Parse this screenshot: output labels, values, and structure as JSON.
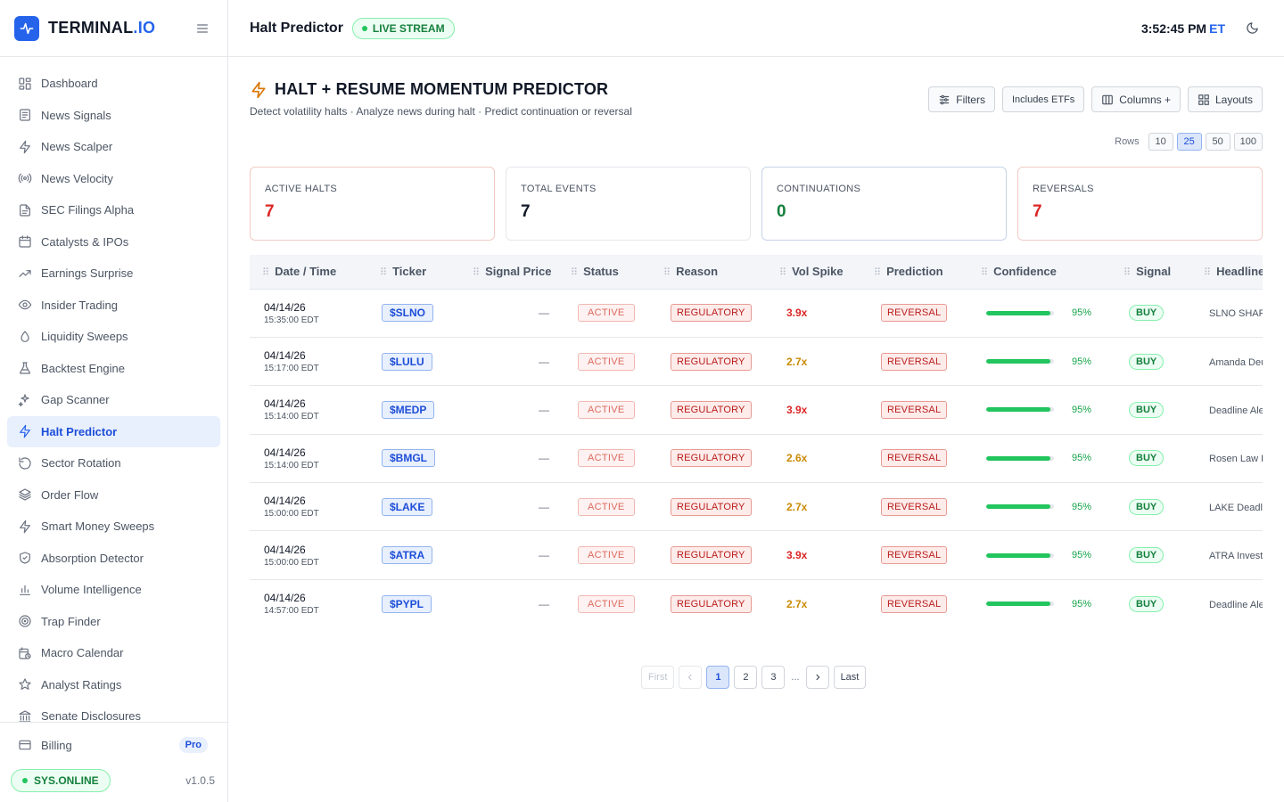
{
  "app": {
    "brand_main": "TERMINAL",
    "brand_accent": ".IO",
    "accent_color": "#2563eb"
  },
  "sidebar": {
    "items": [
      {
        "label": "Dashboard",
        "icon": "grid-icon"
      },
      {
        "label": "News Signals",
        "icon": "newspaper-icon"
      },
      {
        "label": "News Scalper",
        "icon": "bolt-icon"
      },
      {
        "label": "News Velocity",
        "icon": "broadcast-icon"
      },
      {
        "label": "SEC Filings Alpha",
        "icon": "document-icon"
      },
      {
        "label": "Catalysts & IPOs",
        "icon": "calendar-icon"
      },
      {
        "label": "Earnings Surprise",
        "icon": "trending-up-icon"
      },
      {
        "label": "Insider Trading",
        "icon": "eye-icon"
      },
      {
        "label": "Liquidity Sweeps",
        "icon": "droplet-icon"
      },
      {
        "label": "Backtest Engine",
        "icon": "flask-icon"
      },
      {
        "label": "Gap Scanner",
        "icon": "sparkles-icon"
      },
      {
        "label": "Halt Predictor",
        "icon": "bolt-icon"
      },
      {
        "label": "Sector Rotation",
        "icon": "rotate-icon"
      },
      {
        "label": "Order Flow",
        "icon": "layers-icon"
      },
      {
        "label": "Smart Money Sweeps",
        "icon": "bolt-icon"
      },
      {
        "label": "Absorption Detector",
        "icon": "shield-icon"
      },
      {
        "label": "Volume Intelligence",
        "icon": "bar-chart-icon"
      },
      {
        "label": "Trap Finder",
        "icon": "target-icon"
      },
      {
        "label": "Macro Calendar",
        "icon": "calendar-clock-icon"
      },
      {
        "label": "Analyst Ratings",
        "icon": "star-icon"
      },
      {
        "label": "Senate Disclosures",
        "icon": "landmark-icon"
      }
    ],
    "active_label": "Halt Predictor",
    "billing_label": "Billing",
    "billing_badge": "Pro",
    "status_label": "SYS.ONLINE",
    "version": "v1.0.5"
  },
  "topbar": {
    "title": "Halt Predictor",
    "live_label": "LIVE STREAM",
    "clock": "3:52:45 PM",
    "timezone": "ET"
  },
  "header": {
    "title": "HALT + RESUME MOMENTUM PREDICTOR",
    "subtitle": "Detect volatility halts · Analyze news during halt · Predict continuation or reversal"
  },
  "toolbar": {
    "filters_label": "Filters",
    "etf_label": "Includes ETFs",
    "columns_label": "Columns +",
    "layouts_label": "Layouts"
  },
  "rows_control": {
    "label": "Rows",
    "options": [
      "10",
      "25",
      "50",
      "100"
    ],
    "selected": "25"
  },
  "stats": [
    {
      "label": "ACTIVE HALTS",
      "value": "7",
      "color": "#dc2626"
    },
    {
      "label": "TOTAL EVENTS",
      "value": "7",
      "color": "#111827"
    },
    {
      "label": "CONTINUATIONS",
      "value": "0",
      "color": "#15803d"
    },
    {
      "label": "REVERSALS",
      "value": "7",
      "color": "#dc2626"
    }
  ],
  "table": {
    "columns": [
      "Date / Time",
      "Ticker",
      "Signal Price",
      "Status",
      "Reason",
      "Vol Spike",
      "Prediction",
      "Confidence",
      "Signal",
      "Headline"
    ],
    "rows": [
      {
        "date": "04/14/26",
        "time": "15:35:00 EDT",
        "ticker": "$SLNO",
        "price": "—",
        "status": "ACTIVE",
        "reason": "REGULATORY",
        "vol": "3.9x",
        "vol_color": "#dc2626",
        "prediction": "REVERSAL",
        "confidence": 95,
        "confidence_label": "95%",
        "signal": "BUY",
        "headline": "SLNO SHAREHOLDER ALERT"
      },
      {
        "date": "04/14/26",
        "time": "15:17:00 EDT",
        "ticker": "$LULU",
        "price": "—",
        "status": "ACTIVE",
        "reason": "REGULATORY",
        "vol": "2.7x",
        "vol_color": "#ca8a04",
        "prediction": "REVERSAL",
        "confidence": 95,
        "confidence_label": "95%",
        "signal": "BUY",
        "headline": "Amanda Deutsch"
      },
      {
        "date": "04/14/26",
        "time": "15:14:00 EDT",
        "ticker": "$MEDP",
        "price": "—",
        "status": "ACTIVE",
        "reason": "REGULATORY",
        "vol": "3.9x",
        "vol_color": "#dc2626",
        "prediction": "REVERSAL",
        "confidence": 95,
        "confidence_label": "95%",
        "signal": "BUY",
        "headline": "Deadline Alert"
      },
      {
        "date": "04/14/26",
        "time": "15:14:00 EDT",
        "ticker": "$BMGL",
        "price": "—",
        "status": "ACTIVE",
        "reason": "REGULATORY",
        "vol": "2.6x",
        "vol_color": "#ca8a04",
        "prediction": "REVERSAL",
        "confidence": 95,
        "confidence_label": "95%",
        "signal": "BUY",
        "headline": "Rosen Law Firm"
      },
      {
        "date": "04/14/26",
        "time": "15:00:00 EDT",
        "ticker": "$LAKE",
        "price": "—",
        "status": "ACTIVE",
        "reason": "REGULATORY",
        "vol": "2.7x",
        "vol_color": "#ca8a04",
        "prediction": "REVERSAL",
        "confidence": 95,
        "confidence_label": "95%",
        "signal": "BUY",
        "headline": "LAKE Deadline"
      },
      {
        "date": "04/14/26",
        "time": "15:00:00 EDT",
        "ticker": "$ATRA",
        "price": "—",
        "status": "ACTIVE",
        "reason": "REGULATORY",
        "vol": "3.9x",
        "vol_color": "#dc2626",
        "prediction": "REVERSAL",
        "confidence": 95,
        "confidence_label": "95%",
        "signal": "BUY",
        "headline": "ATRA Investors"
      },
      {
        "date": "04/14/26",
        "time": "14:57:00 EDT",
        "ticker": "$PYPL",
        "price": "—",
        "status": "ACTIVE",
        "reason": "REGULATORY",
        "vol": "2.7x",
        "vol_color": "#ca8a04",
        "prediction": "REVERSAL",
        "confidence": 95,
        "confidence_label": "95%",
        "signal": "BUY",
        "headline": "Deadline Alert"
      }
    ]
  },
  "pagination": {
    "first": "First",
    "last": "Last",
    "pages": [
      "1",
      "2",
      "3"
    ],
    "ellipsis": "...",
    "current": "1"
  }
}
